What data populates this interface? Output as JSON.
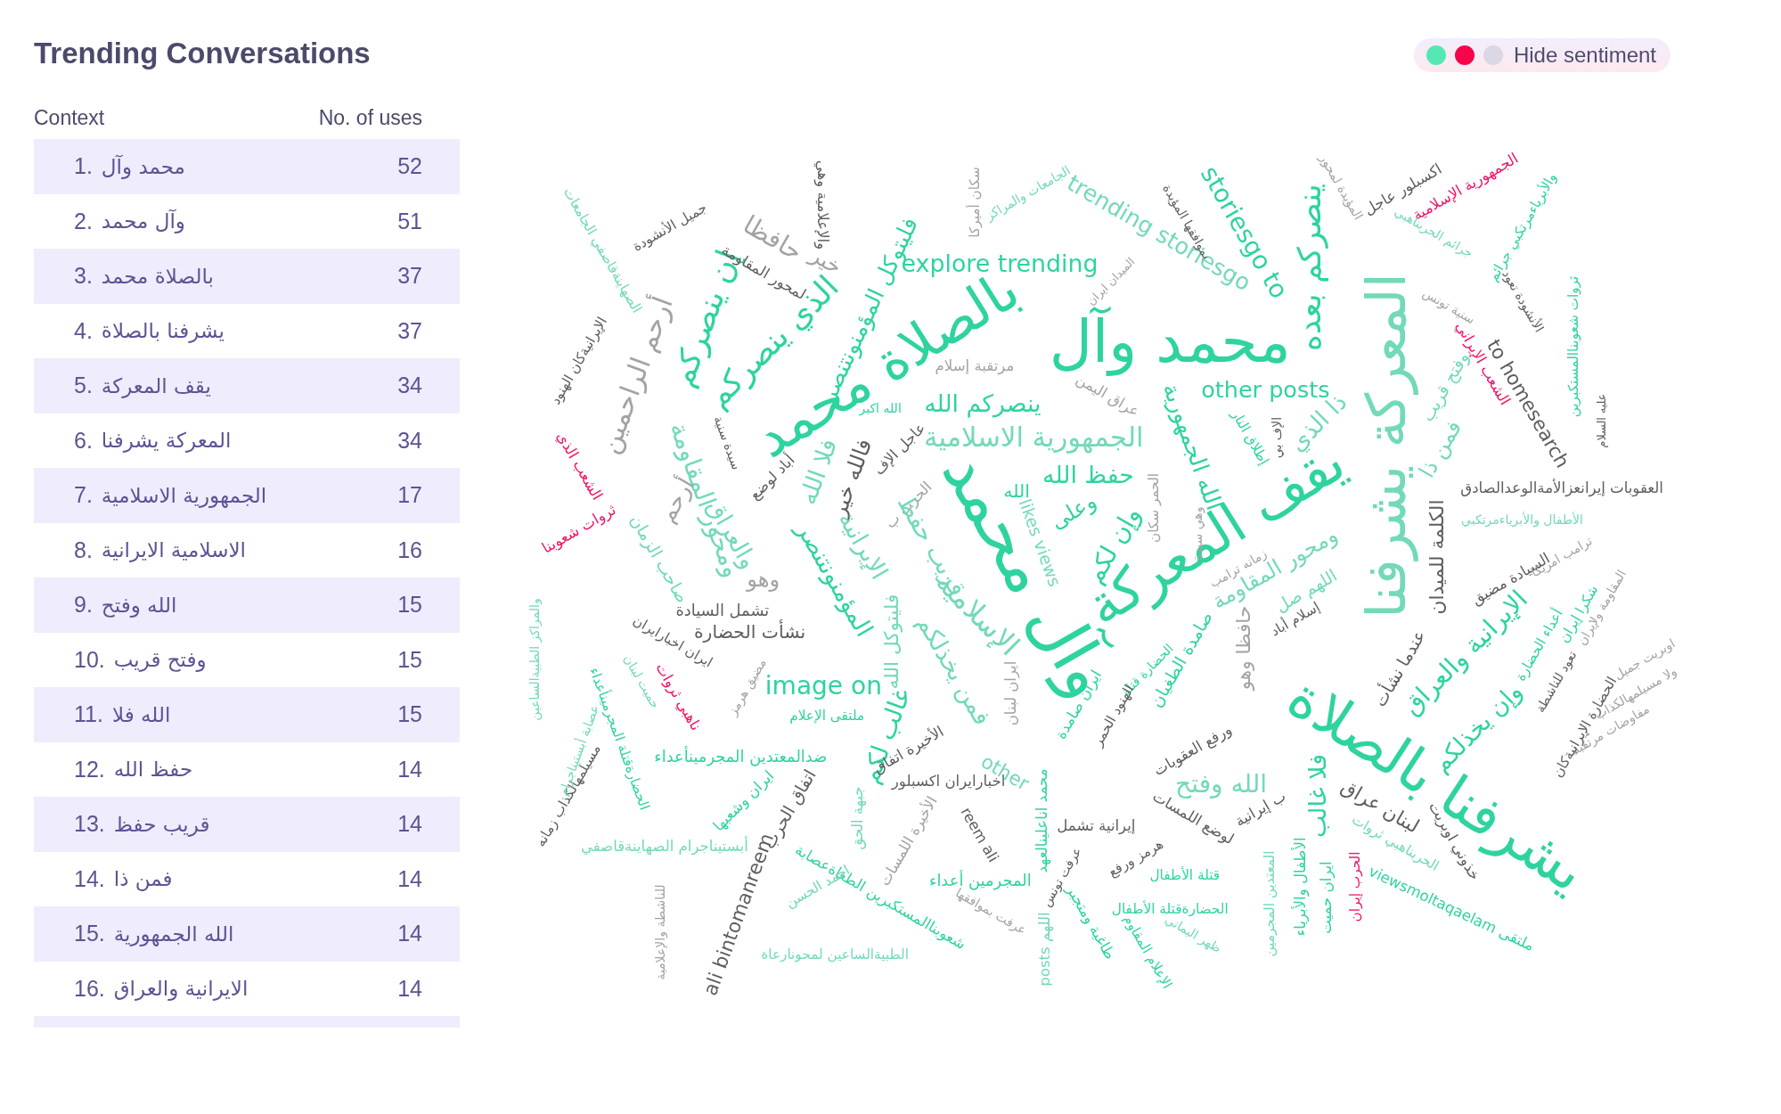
{
  "title": "Trending Conversations",
  "table": {
    "context_header": "Context",
    "uses_header": "No. of uses",
    "rows": [
      {
        "rank": "1.",
        "context": "محمد وآل",
        "uses": "52"
      },
      {
        "rank": "2.",
        "context": "وآل محمد",
        "uses": "51"
      },
      {
        "rank": "3.",
        "context": "بالصلاة محمد",
        "uses": "37"
      },
      {
        "rank": "4.",
        "context": "يشرفنا بالصلاة",
        "uses": "37"
      },
      {
        "rank": "5.",
        "context": "يقف المعركة",
        "uses": "34"
      },
      {
        "rank": "6.",
        "context": "المعركة يشرفنا",
        "uses": "34"
      },
      {
        "rank": "7.",
        "context": "الجمهورية الاسلامية",
        "uses": "17"
      },
      {
        "rank": "8.",
        "context": "الاسلامية الايرانية",
        "uses": "16"
      },
      {
        "rank": "9.",
        "context": "الله وفتح",
        "uses": "15"
      },
      {
        "rank": "10.",
        "context": "وفتح قريب",
        "uses": "15"
      },
      {
        "rank": "11.",
        "context": "الله فلا",
        "uses": "15"
      },
      {
        "rank": "12.",
        "context": "حفظ الله",
        "uses": "14"
      },
      {
        "rank": "13.",
        "context": "قريب حفظ",
        "uses": "14"
      },
      {
        "rank": "14.",
        "context": "فمن ذا",
        "uses": "14"
      },
      {
        "rank": "15.",
        "context": "الله الجمهورية",
        "uses": "14"
      },
      {
        "rank": "16.",
        "context": "الايرانية والعراق",
        "uses": "14"
      }
    ]
  },
  "legend": {
    "dots": [
      {
        "color": "#55e8b4"
      },
      {
        "color": "#f5064a"
      },
      {
        "color": "#dcd7e4"
      }
    ],
    "label": "Hide sentiment"
  },
  "cloud": [
    {
      "text": "محمد وآل",
      "color": "#2ed3a0"
    },
    {
      "text": "بالصلاة محمد",
      "color": "#2ed3a0"
    },
    {
      "text": "يشرفنا بالصلاة",
      "color": "#2ed3a0"
    },
    {
      "text": "يقف المعركة",
      "color": "#2ed3a0"
    },
    {
      "text": "المعركة يشرفنا",
      "color": "#72d9b9"
    },
    {
      "text": "وآل محمد",
      "color": "#2ed3a0"
    },
    {
      "text": "ينصركم بعده",
      "color": "#2ed3a0"
    },
    {
      "text": "storiesgo to",
      "color": "#2ed3a0"
    },
    {
      "text": "trending storiesgo",
      "color": "#72d9b9"
    },
    {
      "text": "explore trending",
      "color": "#2ed3a0"
    },
    {
      "text": "other posts",
      "color": "#2ed3a0"
    },
    {
      "text": "image on",
      "color": "#2ed3a0"
    },
    {
      "text": "to homesearch",
      "color": "#5e5e5e"
    },
    {
      "text": "الذي ينصركم",
      "color": "#2ed3a0"
    },
    {
      "text": "إن ينصركم",
      "color": "#2ed3a0"
    },
    {
      "text": "فليتوكل المؤمنونتنصر",
      "color": "#2ed3a0"
    },
    {
      "text": "أرحم الراحمين",
      "color": "#a3a3a3"
    },
    {
      "text": "حافظا",
      "color": "#a3a3a3"
    },
    {
      "text": "خير",
      "color": "#a3a3a3"
    },
    {
      "text": "والإعلامية وهي",
      "color": "#5e5e5e"
    },
    {
      "text": "لمحور المقاومة",
      "color": "#5e5e5e"
    },
    {
      "text": "جميل الأنشودة",
      "color": "#5e5e5e"
    },
    {
      "text": "الصهاينةقاصفي الجامعات",
      "color": "#72d9b9"
    },
    {
      "text": "الإيرانيةكان الهنود",
      "color": "#5e5e5e"
    },
    {
      "text": "الشعب الذي",
      "color": "#f2156a"
    },
    {
      "text": "ثروات شعوبنا",
      "color": "#f2156a"
    },
    {
      "text": "سكان أميركا",
      "color": "#a3a3a3"
    },
    {
      "text": "مرتقبة إسلام",
      "color": "#a3a3a3"
    },
    {
      "text": "عراق اليمن",
      "color": "#a3a3a3"
    },
    {
      "text": "ينصركم الله",
      "color": "#2ed3a0"
    },
    {
      "text": "الله اكبر",
      "color": "#2ed3a0"
    },
    {
      "text": "الجمهورية الاسلامية",
      "color": "#72d9b9"
    },
    {
      "text": "سيدة سنية",
      "color": "#5e5e5e"
    },
    {
      "text": "ومحور المقاومة",
      "color": "#72d9b9"
    },
    {
      "text": "أباد لوضع",
      "color": "#5e5e5e"
    },
    {
      "text": "فالله خير",
      "color": "#5e5e5e"
    },
    {
      "text": "فلا الله",
      "color": "#72d9b9"
    },
    {
      "text": "عاجل الإف",
      "color": "#5e5e5e"
    },
    {
      "text": "الحرب ب",
      "color": "#a3a3a3"
    },
    {
      "text": "حفظ الله",
      "color": "#2ed3a0"
    },
    {
      "text": "الله",
      "color": "#2ed3a0"
    },
    {
      "text": "وعلى",
      "color": "#2ed3a0"
    },
    {
      "text": "وإن لكم",
      "color": "#2ed3a0"
    },
    {
      "text": "likes views",
      "color": "#72d9b9"
    },
    {
      "text": "المؤمنونتنصر",
      "color": "#2ed3a0"
    },
    {
      "text": "غالب لكم",
      "color": "#2ed3a0"
    },
    {
      "text": "والعراق",
      "color": "#72d9b9"
    },
    {
      "text": "الإيرانية",
      "color": "#72d9b9"
    },
    {
      "text": "الإسلامية",
      "color": "#72d9b9"
    },
    {
      "text": "أرحم",
      "color": "#a3a3a3"
    },
    {
      "text": "وهو",
      "color": "#a3a3a3"
    },
    {
      "text": "صاحب الزمان",
      "color": "#72d9b9"
    },
    {
      "text": "تشمل السيادة",
      "color": "#5e5e5e"
    },
    {
      "text": "نشأت الحضارة",
      "color": "#5e5e5e"
    },
    {
      "text": "ايران اخبارايران",
      "color": "#5e5e5e"
    },
    {
      "text": "ناهبي ثروات",
      "color": "#f2156a"
    },
    {
      "text": "ملتقى الإعلام",
      "color": "#2ed3a0"
    },
    {
      "text": "ضدالمعتدين المجرمينأعداء",
      "color": "#2ed3a0"
    },
    {
      "text": "ايران وشعبها",
      "color": "#2ed3a0"
    },
    {
      "text": "الحضارةقتلة المجرمينأعداء",
      "color": "#2ed3a0"
    },
    {
      "text": "مسيلمهالكذاب زمانه",
      "color": "#5e5e5e"
    },
    {
      "text": "والمراكز الطبيةالساعين",
      "color": "#72d9b9"
    },
    {
      "text": "أبستيناجرام الصهاينةقاصفي",
      "color": "#72d9b9"
    },
    {
      "text": "للناشطة والإعلامية",
      "color": "#a3a3a3"
    },
    {
      "text": "ali bintomanreem",
      "color": "#5e5e5e"
    },
    {
      "text": "اتفاق الحرب",
      "color": "#5e5e5e"
    },
    {
      "text": "جبهة الحق",
      "color": "#72d9b9"
    },
    {
      "text": "الأخيرة اتفاق",
      "color": "#5e5e5e"
    },
    {
      "text": "اخبارايران اكسبلور",
      "color": "#5e5e5e"
    },
    {
      "text": "reem ali",
      "color": "#5e5e5e"
    },
    {
      "text": "شعوبناالمستكبرين الطغاةعصابة",
      "color": "#2ed3a0"
    },
    {
      "text": "المجرمين أعداء",
      "color": "#2ed3a0"
    },
    {
      "text": "احمد الحسن",
      "color": "#72d9b9"
    },
    {
      "text": "الطبيةالساعين لمحونارعاة",
      "color": "#72d9b9"
    },
    {
      "text": "عرفت بموافقها",
      "color": "#a3a3a3"
    },
    {
      "text": "محمد اناعلينالعهد",
      "color": "#2ed3a0"
    },
    {
      "text": "posts اللهم",
      "color": "#72d9b9"
    },
    {
      "text": "عرفت تونس",
      "color": "#5e5e5e"
    },
    {
      "text": "طاغية ومتجبر",
      "color": "#2ed3a0"
    },
    {
      "text": "إيرانية تشمل",
      "color": "#5e5e5e"
    },
    {
      "text": "هرمز ورفع",
      "color": "#5e5e5e"
    },
    {
      "text": "قتلة الأطفال",
      "color": "#2ed3a0"
    },
    {
      "text": "الحضارةقتلة الأطفال",
      "color": "#2ed3a0"
    },
    {
      "text": "الإعلام المقاوم",
      "color": "#2ed3a0"
    },
    {
      "text": "ظهر اليماني",
      "color": "#72d9b9"
    },
    {
      "text": "لوضع اللمسات",
      "color": "#5e5e5e"
    },
    {
      "text": "ورفع العقوبات",
      "color": "#5e5e5e"
    },
    {
      "text": "الله وفتح",
      "color": "#72d9b9"
    },
    {
      "text": "ب إيرانية",
      "color": "#5e5e5e"
    },
    {
      "text": "المعتدين المجرمين",
      "color": "#72d9b9"
    },
    {
      "text": "الأطفال والأبرياء",
      "color": "#2ed3a0"
    },
    {
      "text": "فلا غالب",
      "color": "#2ed3a0"
    },
    {
      "text": "ايران حميت",
      "color": "#2ed3a0"
    },
    {
      "text": "الحرب إيران",
      "color": "#f2156a"
    },
    {
      "text": "لبنان عراق",
      "color": "#5e5e5e"
    },
    {
      "text": "خذوني اوبريت",
      "color": "#5e5e5e"
    },
    {
      "text": "viewsmoltaqaelam ملتقى",
      "color": "#2ed3a0"
    },
    {
      "text": "الحربناهبي ثروات",
      "color": "#72d9b9"
    },
    {
      "text": "وإن يخذلكم",
      "color": "#2ed3a0"
    },
    {
      "text": "الإيرانية والعراق",
      "color": "#2ed3a0"
    },
    {
      "text": "عندما نشأت",
      "color": "#5e5e5e"
    },
    {
      "text": "الكلمة للميدان",
      "color": "#5e5e5e"
    },
    {
      "text": "السيادة مضيق",
      "color": "#5e5e5e"
    },
    {
      "text": "ترامب امريكا",
      "color": "#a3a3a3"
    },
    {
      "text": "العقوبات إيرانعزالأمةالوعدالصادق",
      "color": "#5e5e5e"
    },
    {
      "text": "الأطفال والأبرياءمرتكبي",
      "color": "#72d9b9"
    },
    {
      "text": "أعداء الحضارة",
      "color": "#2ed3a0"
    },
    {
      "text": "شكرا إيران",
      "color": "#2ed3a0"
    },
    {
      "text": "المقاومة ولإيران",
      "color": "#a3a3a3"
    },
    {
      "text": "اوبريت جميل",
      "color": "#a3a3a3"
    },
    {
      "text": "ولا مسيلمهالكذاب",
      "color": "#a3a3a3"
    },
    {
      "text": "مفاوضات مرتقبة",
      "color": "#a3a3a3"
    },
    {
      "text": "الحضارة الإيرانيةكان",
      "color": "#5e5e5e"
    },
    {
      "text": "تعود للناشطة",
      "color": "#5e5e5e"
    },
    {
      "text": "اكسبلور عاجل",
      "color": "#5e5e5e"
    },
    {
      "text": "الجمهورية الإسلامية",
      "color": "#f2156a"
    },
    {
      "text": "والأبرياءمرتكبي جرائم",
      "color": "#2ed3a0"
    },
    {
      "text": "جرائم الحربناهبي",
      "color": "#72d9b9"
    },
    {
      "text": "سنية تونس",
      "color": "#a3a3a3"
    },
    {
      "text": "الأنشودة تعود",
      "color": "#5e5e5e"
    },
    {
      "text": "الشعب الإيراني",
      "color": "#f2156a"
    },
    {
      "text": "ثروات شعوبناالمستكبرين",
      "color": "#2ed3a0"
    },
    {
      "text": "عليه السلام",
      "color": "#5e5e5e"
    },
    {
      "text": "فمن ذا",
      "color": "#72d9b9"
    },
    {
      "text": "وفتح قريب",
      "color": "#72d9b9"
    },
    {
      "text": "بموافقها المؤيدة",
      "color": "#5e5e5e"
    },
    {
      "text": "الميدان ايران",
      "color": "#a3a3a3"
    },
    {
      "text": "المؤيدة لمحور",
      "color": "#a3a3a3"
    },
    {
      "text": "الله الجمهورية",
      "color": "#2ed3a0"
    },
    {
      "text": "إطلاق النار",
      "color": "#2ed3a0"
    },
    {
      "text": "الإف بي",
      "color": "#5e5e5e"
    },
    {
      "text": "ذا الذي",
      "color": "#72d9b9"
    },
    {
      "text": "الحمر سكان",
      "color": "#a3a3a3"
    },
    {
      "text": "وهي سيدة",
      "color": "#a3a3a3"
    },
    {
      "text": "زمانه ترامب",
      "color": "#a3a3a3"
    },
    {
      "text": "ومحور المقاومة",
      "color": "#72d9b9"
    },
    {
      "text": "اللهم صل",
      "color": "#72d9b9"
    },
    {
      "text": "صامدة الطغيان",
      "color": "#2ed3a0"
    },
    {
      "text": "حافظا وهو",
      "color": "#a3a3a3"
    },
    {
      "text": "إسلام أباد",
      "color": "#5e5e5e"
    },
    {
      "text": "الحضارة قتلة",
      "color": "#2ed3a0"
    },
    {
      "text": "الهنود الحمر",
      "color": "#5e5e5e"
    },
    {
      "text": "ايران صامدة",
      "color": "#2ed3a0"
    },
    {
      "text": "ايران لبنان",
      "color": "#a3a3a3"
    },
    {
      "text": "فمن يخذلكم",
      "color": "#72d9b9"
    },
    {
      "text": "other",
      "color": "#72d9b9"
    },
    {
      "text": "فليتوكل الله",
      "color": "#72d9b9"
    },
    {
      "text": "مضيق هرمز",
      "color": "#a3a3a3"
    },
    {
      "text": "حميت لبنان",
      "color": "#72d9b9"
    },
    {
      "text": "الأخيرة اللمسات",
      "color": "#a3a3a3"
    },
    {
      "text": "قريب حفظ",
      "color": "#72d9b9"
    },
    {
      "text": "عصابة أبستيناجرام",
      "color": "#72d9b9"
    },
    {
      "text": "الجامعات والمراكز",
      "color": "#72d9b9"
    }
  ]
}
